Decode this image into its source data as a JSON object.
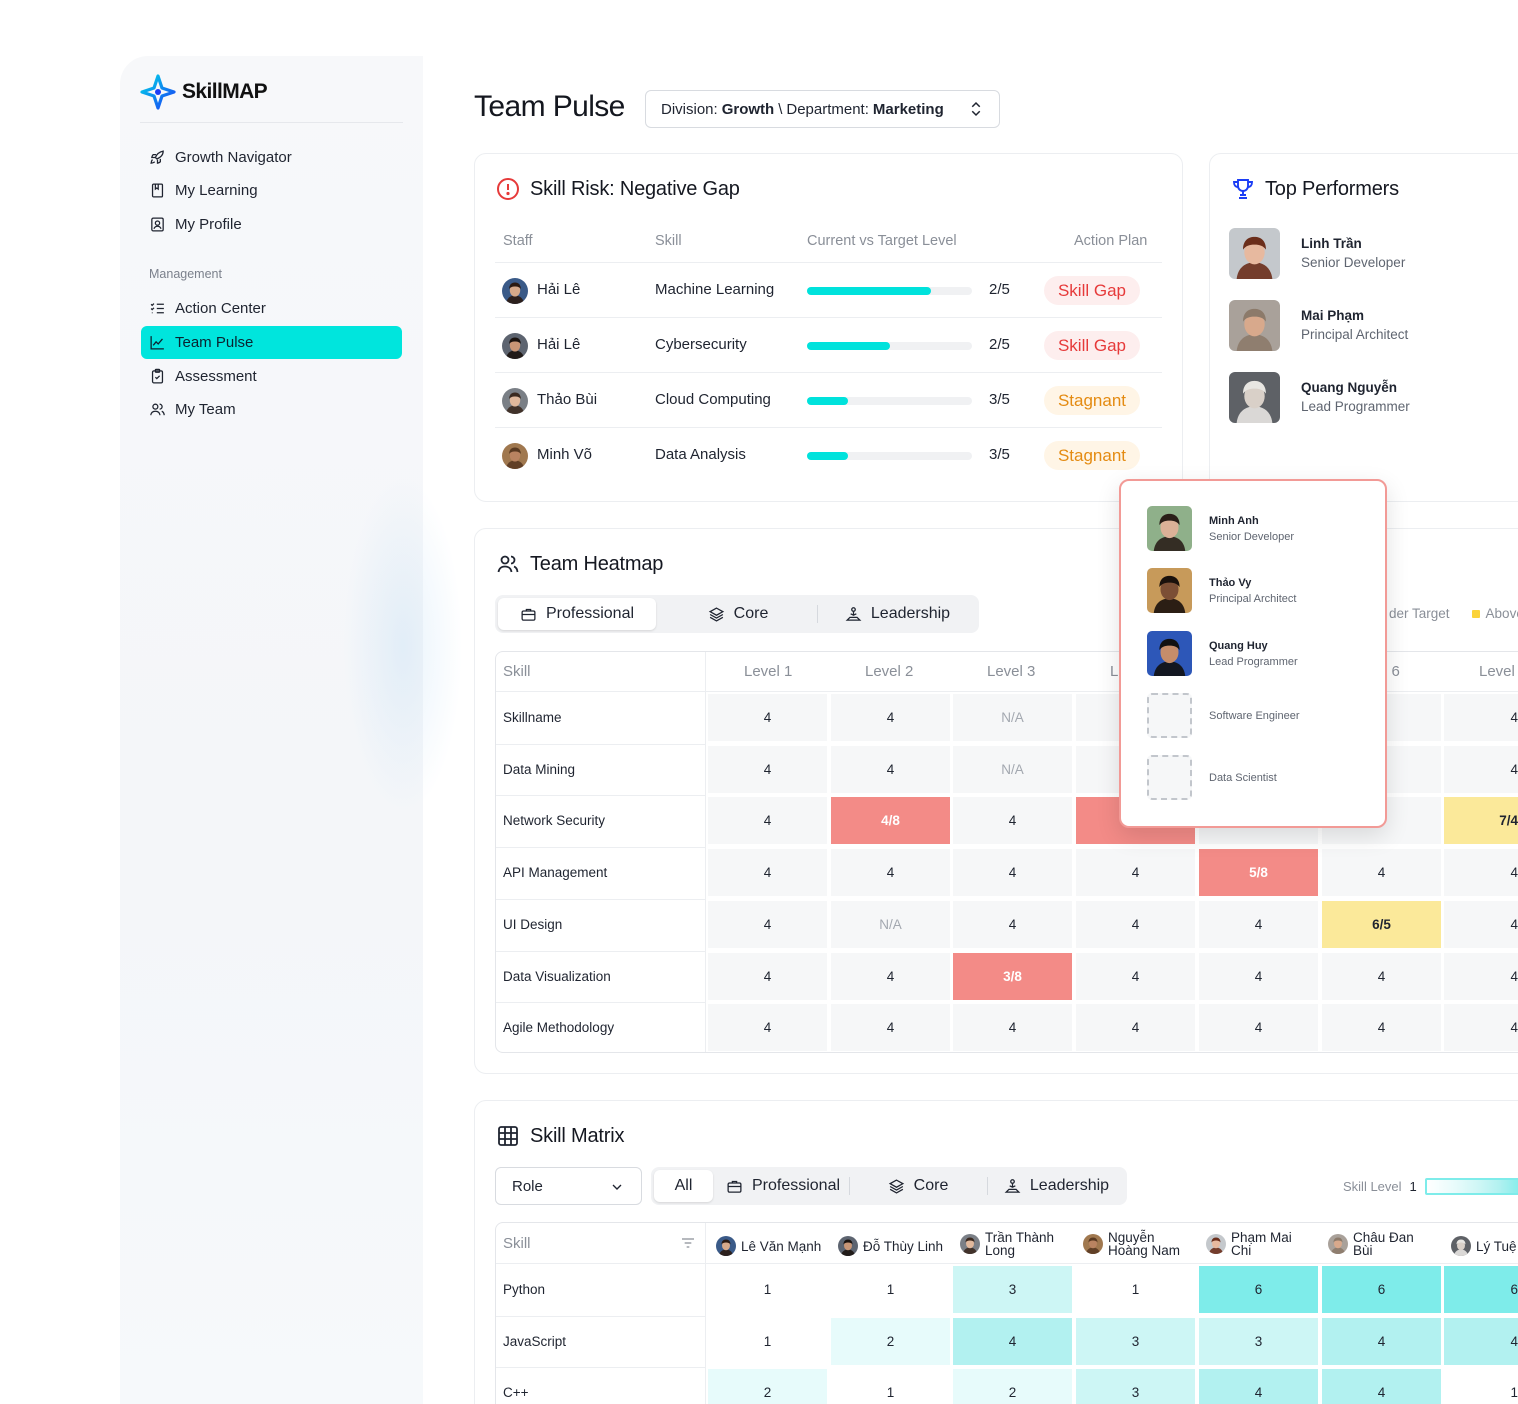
{
  "app": {
    "name": "SkillMAP"
  },
  "sidebar": {
    "items": [
      {
        "label": "Growth Navigator",
        "icon": "rocket-icon"
      },
      {
        "label": "My Learning",
        "icon": "book-icon"
      },
      {
        "label": "My Profile",
        "icon": "profile-card-icon"
      }
    ],
    "section_label": "Management",
    "management_items": [
      {
        "label": "Action Center",
        "icon": "checklist-icon"
      },
      {
        "label": "Team Pulse",
        "icon": "line-chart-icon",
        "active": true
      },
      {
        "label": "Assessment",
        "icon": "clipboard-icon"
      },
      {
        "label": "My Team",
        "icon": "users-icon"
      }
    ]
  },
  "header": {
    "title": "Team Pulse",
    "division_label": "Division:",
    "division_value": "Growth",
    "separator": "\\",
    "department_label": "Department:",
    "department_value": "Marketing"
  },
  "skill_risk": {
    "title": "Skill Risk: Negative Gap",
    "columns": [
      "Staff",
      "Skill",
      "Current vs Target Level",
      "Action Plan"
    ],
    "rows": [
      {
        "staff": "Hải Lê",
        "skill": "Machine Learning",
        "progress": 0.75,
        "level": "2/5",
        "action": "Skill Gap",
        "type": "gap"
      },
      {
        "staff": "Hải Lê",
        "skill": "Cybersecurity",
        "progress": 0.5,
        "level": "2/5",
        "action": "Skill Gap",
        "type": "gap"
      },
      {
        "staff": "Thảo Bùi",
        "skill": "Cloud Computing",
        "progress": 0.25,
        "level": "3/5",
        "action": "Stagnant",
        "type": "stag"
      },
      {
        "staff": "Minh Võ",
        "skill": "Data Analysis",
        "progress": 0.25,
        "level": "3/5",
        "action": "Stagnant",
        "type": "stag"
      }
    ]
  },
  "top_performers": {
    "title": "Top Performers",
    "people": [
      {
        "name": "Linh Trần",
        "role": "Senior Developer"
      },
      {
        "name": "Mai Phạm",
        "role": "Principal Architect"
      },
      {
        "name": "Quang Nguyễn",
        "role": "Lead Programmer"
      }
    ]
  },
  "heatmap": {
    "title": "Team Heatmap",
    "tabs": [
      "Professional",
      "Core",
      "Leadership"
    ],
    "legend": [
      "der Target",
      "Above"
    ],
    "columns": [
      "Skill",
      "Level 1",
      "Level 2",
      "Level 3",
      "L",
      "l 6",
      "Level"
    ],
    "rows": [
      {
        "skill": "Skillname",
        "cells": [
          "4",
          "4",
          "N/A",
          "",
          "",
          "",
          "4"
        ]
      },
      {
        "skill": "Data Mining",
        "cells": [
          "4",
          "4",
          "N/A",
          "",
          "",
          "",
          "4"
        ]
      },
      {
        "skill": "Network Security",
        "cells": [
          "4",
          "4/8",
          "4",
          "",
          "",
          "",
          "7/4"
        ]
      },
      {
        "skill": "API Management",
        "cells": [
          "4",
          "4",
          "4",
          "4",
          "5/8",
          "4",
          "4"
        ]
      },
      {
        "skill": "UI Design",
        "cells": [
          "4",
          "N/A",
          "4",
          "4",
          "4",
          "6/5",
          "4"
        ]
      },
      {
        "skill": "Data Visualization",
        "cells": [
          "4",
          "4",
          "3/8",
          "4",
          "4",
          "4",
          "4"
        ]
      },
      {
        "skill": "Agile Methodology",
        "cells": [
          "4",
          "4",
          "4",
          "4",
          "4",
          "4",
          "4"
        ]
      }
    ]
  },
  "popup": {
    "people": [
      {
        "name": "Minh Anh",
        "role": "Senior Developer"
      },
      {
        "name": "Thảo Vy",
        "role": "Principal Architect"
      },
      {
        "name": "Quang Huy",
        "role": "Lead Programmer"
      },
      {
        "name": "",
        "role": "Software Engineer"
      },
      {
        "name": "",
        "role": "Data Scientist"
      }
    ]
  },
  "skill_matrix": {
    "title": "Skill Matrix",
    "role_select": "Role",
    "tabs": [
      "All",
      "Professional",
      "Core",
      "Leadership"
    ],
    "legend_label": "Skill Level",
    "legend_value": "1",
    "skill_header": "Skill",
    "employees": [
      [
        "Lê Văn Mạnh"
      ],
      [
        "Đỗ Thùy Linh"
      ],
      [
        "Trần Thành",
        "Long"
      ],
      [
        "Nguyễn",
        "Hoàng Nam"
      ],
      [
        "Phạm Mai",
        "Chi"
      ],
      [
        "Châu Đan",
        "Bùi"
      ],
      [
        "Lý Tuệ"
      ]
    ],
    "rows": [
      {
        "skill": "Python",
        "values": [
          "1",
          "1",
          "3",
          "1",
          "6",
          "6",
          "6"
        ]
      },
      {
        "skill": "JavaScript",
        "values": [
          "1",
          "2",
          "4",
          "3",
          "3",
          "4",
          "4"
        ]
      },
      {
        "skill": "C++",
        "values": [
          "2",
          "1",
          "2",
          "3",
          "4",
          "4",
          "1"
        ]
      }
    ]
  }
}
